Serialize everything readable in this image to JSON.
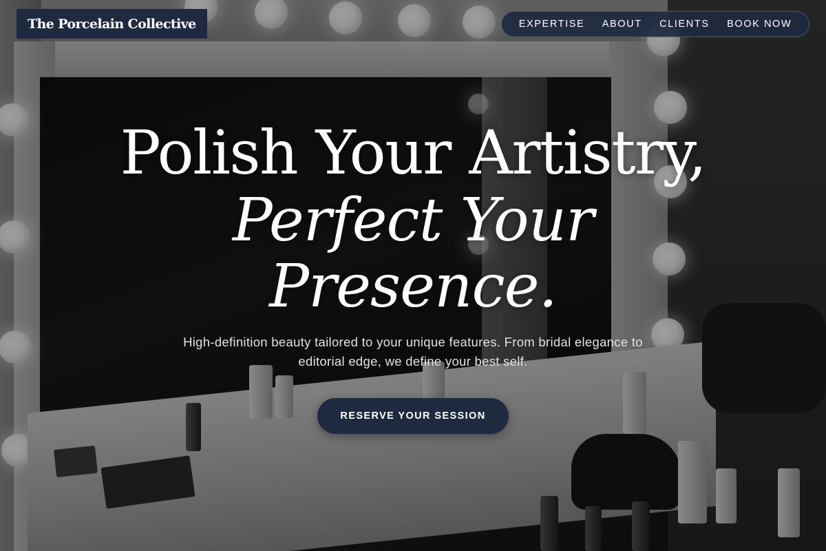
{
  "brand": {
    "name": "The Porcelain Collective",
    "color": "#1f2a40"
  },
  "nav": {
    "items": [
      {
        "label": "EXPERTISE"
      },
      {
        "label": "ABOUT"
      },
      {
        "label": "CLIENTS"
      },
      {
        "label": "BOOK NOW"
      }
    ]
  },
  "hero": {
    "title_line1": "Polish Your Artistry,",
    "title_line2": "Perfect Your",
    "title_line3": "Presence.",
    "subtitle": "High-definition beauty tailored to your unique features. From bridal elegance to editorial edge, we define your best self.",
    "cta_label": "RESERVE YOUR SESSION",
    "background_icon": "vanity-mirror-photo"
  }
}
